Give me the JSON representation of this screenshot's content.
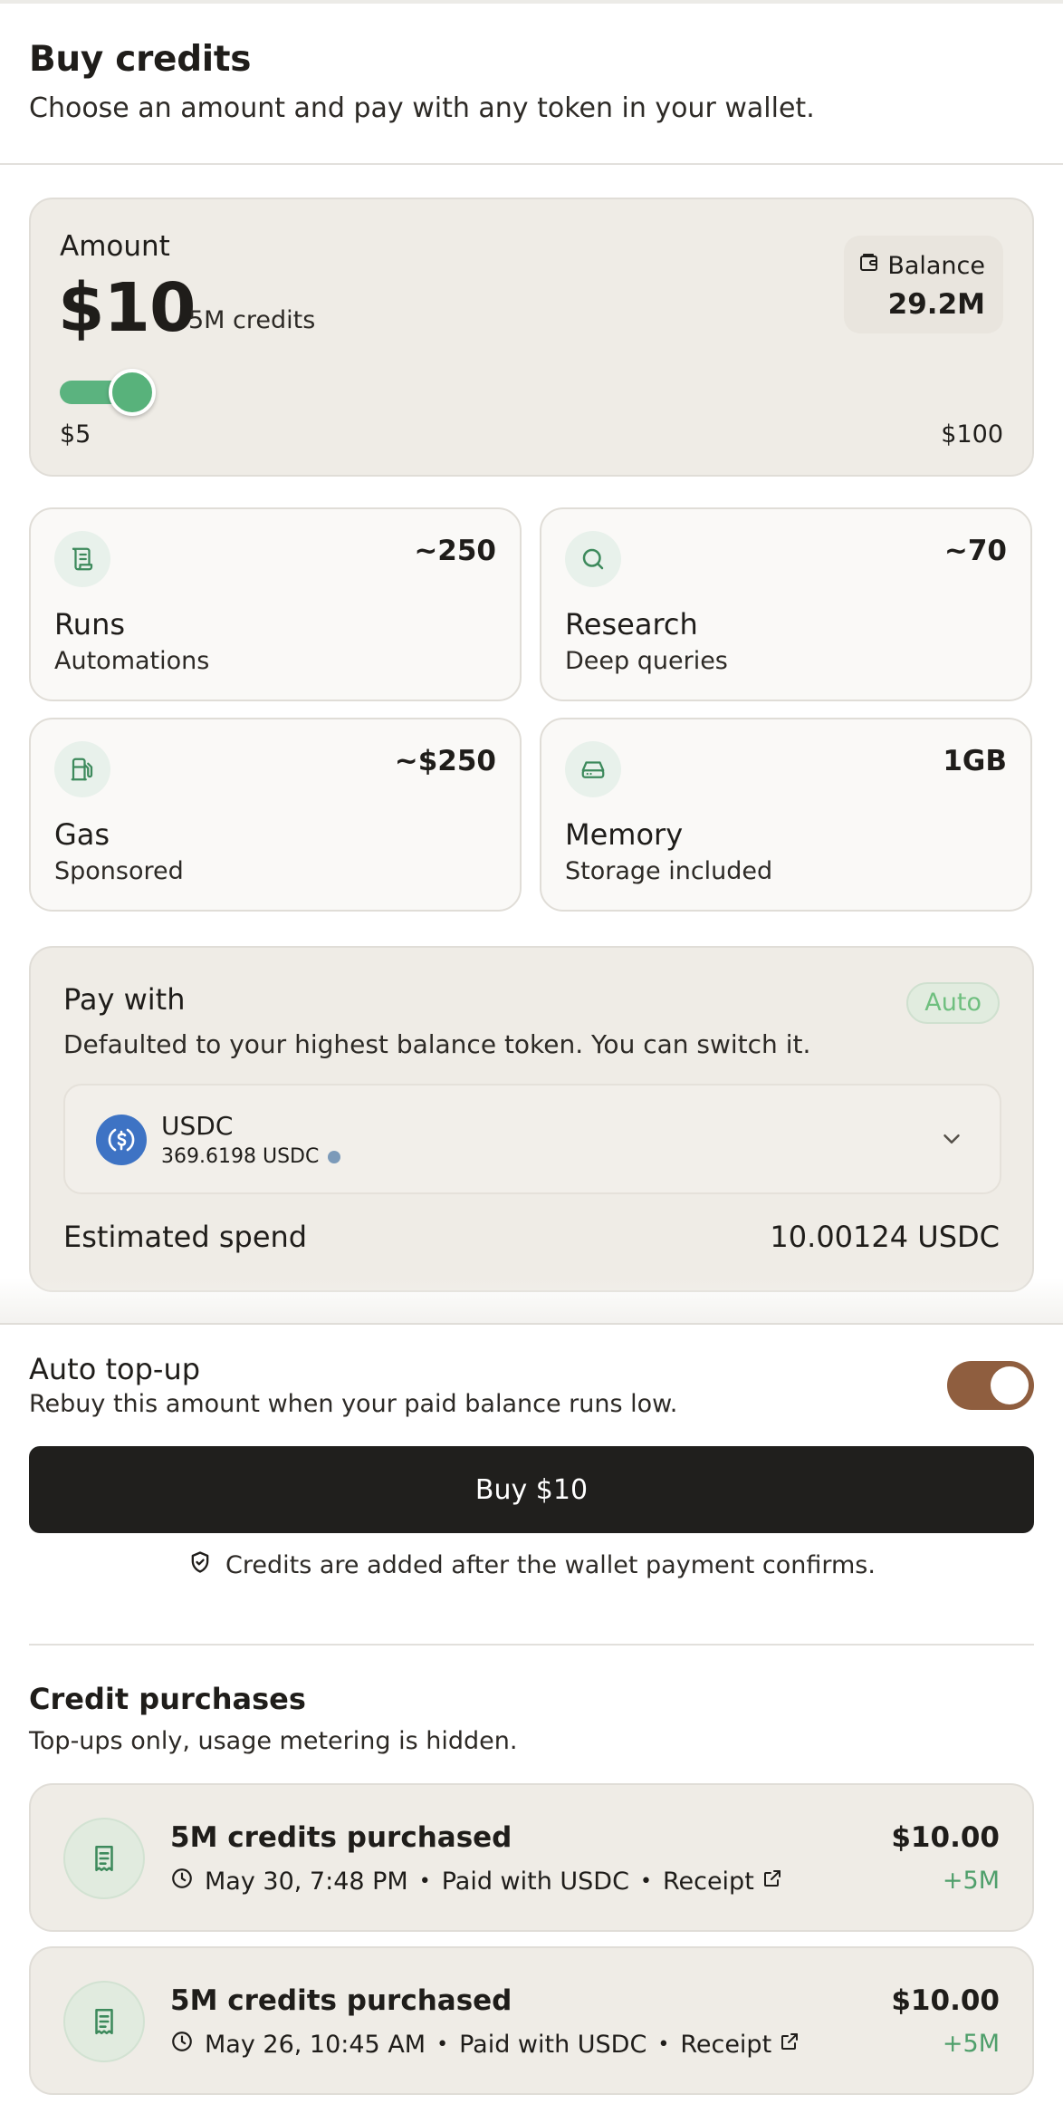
{
  "header": {
    "title": "Buy credits",
    "subtitle": "Choose an amount and pay with any token in your wallet."
  },
  "amount": {
    "label": "Amount",
    "value": "$10",
    "credits": "5M credits",
    "slider_min": "$5",
    "slider_max": "$100",
    "slider_fraction": 0.053
  },
  "balance": {
    "label": "Balance",
    "value": "29.2M"
  },
  "stats": [
    {
      "title": "Runs",
      "sub": "Automations",
      "value": "~250",
      "icon": "scroll-icon"
    },
    {
      "title": "Research",
      "sub": "Deep queries",
      "value": "~70",
      "icon": "search-icon"
    },
    {
      "title": "Gas",
      "sub": "Sponsored",
      "value": "~$250",
      "icon": "fuel-pump-icon"
    },
    {
      "title": "Memory",
      "sub": "Storage included",
      "value": "1GB",
      "icon": "hard-drive-icon"
    }
  ],
  "pay": {
    "title": "Pay with",
    "badge": "Auto",
    "description": "Defaulted to your highest balance token. You can switch it.",
    "token_name": "USDC",
    "token_balance": "369.6198 USDC",
    "estimate_label": "Estimated spend",
    "estimate_value": "10.00124 USDC"
  },
  "auto_topup": {
    "title": "Auto top-up",
    "description": "Rebuy this amount when your paid balance runs low.",
    "enabled": true
  },
  "buy_button": "Buy $10",
  "note": "Credits are added after the wallet payment confirms.",
  "purchases": {
    "title": "Credit purchases",
    "subtitle": "Top-ups only, usage metering is hidden.",
    "items": [
      {
        "title": "5M credits purchased",
        "date": "May 30, 7:48 PM",
        "paid": "Paid with USDC",
        "receipt": "Receipt",
        "amount": "$10.00",
        "credits": "+5M"
      },
      {
        "title": "5M credits purchased",
        "date": "May 26, 10:45 AM",
        "paid": "Paid with USDC",
        "receipt": "Receipt",
        "amount": "$10.00",
        "credits": "+5M"
      }
    ]
  },
  "colors": {
    "accent_green": "#58b27b",
    "toggle_brown": "#8f5e3f",
    "button_dark": "#201f1d",
    "card_beige": "#efece6"
  }
}
